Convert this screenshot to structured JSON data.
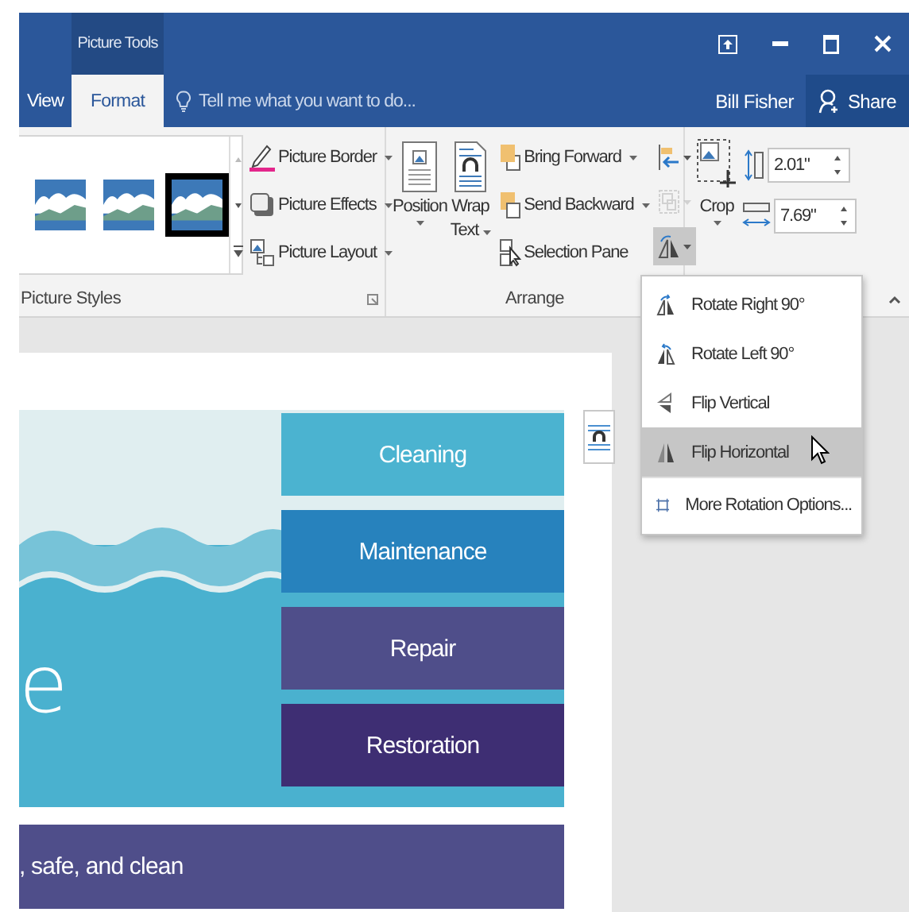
{
  "title_bar": {
    "context_tab": "Picture Tools"
  },
  "tabs": [
    {
      "label": "View",
      "selected": false
    },
    {
      "label": "Format",
      "selected": true
    }
  ],
  "tell_me": {
    "placeholder": "Tell me what you want to do..."
  },
  "user": "Bill Fisher",
  "share": "Share",
  "picture_styles": {
    "label": "Picture Styles",
    "gallery": [
      {
        "selected": false
      },
      {
        "selected": false
      },
      {
        "selected": true
      }
    ],
    "commands": [
      {
        "kind": "border",
        "label": "Picture Border"
      },
      {
        "kind": "effects",
        "label": "Picture Effects"
      },
      {
        "kind": "layout",
        "label": "Picture Layout"
      }
    ]
  },
  "arrange": {
    "label": "Arrange",
    "position": "Position",
    "wrap": [
      "Wrap",
      "Text"
    ],
    "commands": [
      {
        "kind": "forward",
        "label": "Bring Forward"
      },
      {
        "kind": "backward",
        "label": "Send Backward"
      },
      {
        "kind": "pane",
        "label": "Selection Pane"
      }
    ],
    "small_buttons": [
      {
        "kind": "align",
        "disabled": false,
        "pressed": false
      },
      {
        "kind": "group",
        "disabled": true,
        "pressed": false
      },
      {
        "kind": "rotate",
        "disabled": false,
        "pressed": true
      }
    ]
  },
  "size": {
    "crop": "Crop",
    "height": "2.01\"",
    "width": "7.69\""
  },
  "rotate_menu": [
    {
      "kind": "rotate-right",
      "label": "Rotate Right 90°",
      "selected": false
    },
    {
      "kind": "rotate-left",
      "label": "Rotate Left 90°",
      "selected": false
    },
    {
      "kind": "flip-vertical",
      "label": "Flip Vertical",
      "selected": false
    },
    {
      "kind": "flip-horizontal",
      "label": "Flip Horizontal",
      "selected": true
    },
    {
      "kind": "more",
      "label": "More Rotation Options...",
      "selected": false
    }
  ],
  "document": {
    "heading_fragment": "e",
    "services": [
      {
        "label": "Cleaning",
        "color": "#4bb3d0"
      },
      {
        "label": "Maintenance",
        "color": "#2782bd"
      },
      {
        "label": "Repair",
        "color": "#4f4e8a"
      },
      {
        "label": "Restoration",
        "color": "#3e2e73"
      }
    ],
    "banner": ", safe, and clean"
  }
}
